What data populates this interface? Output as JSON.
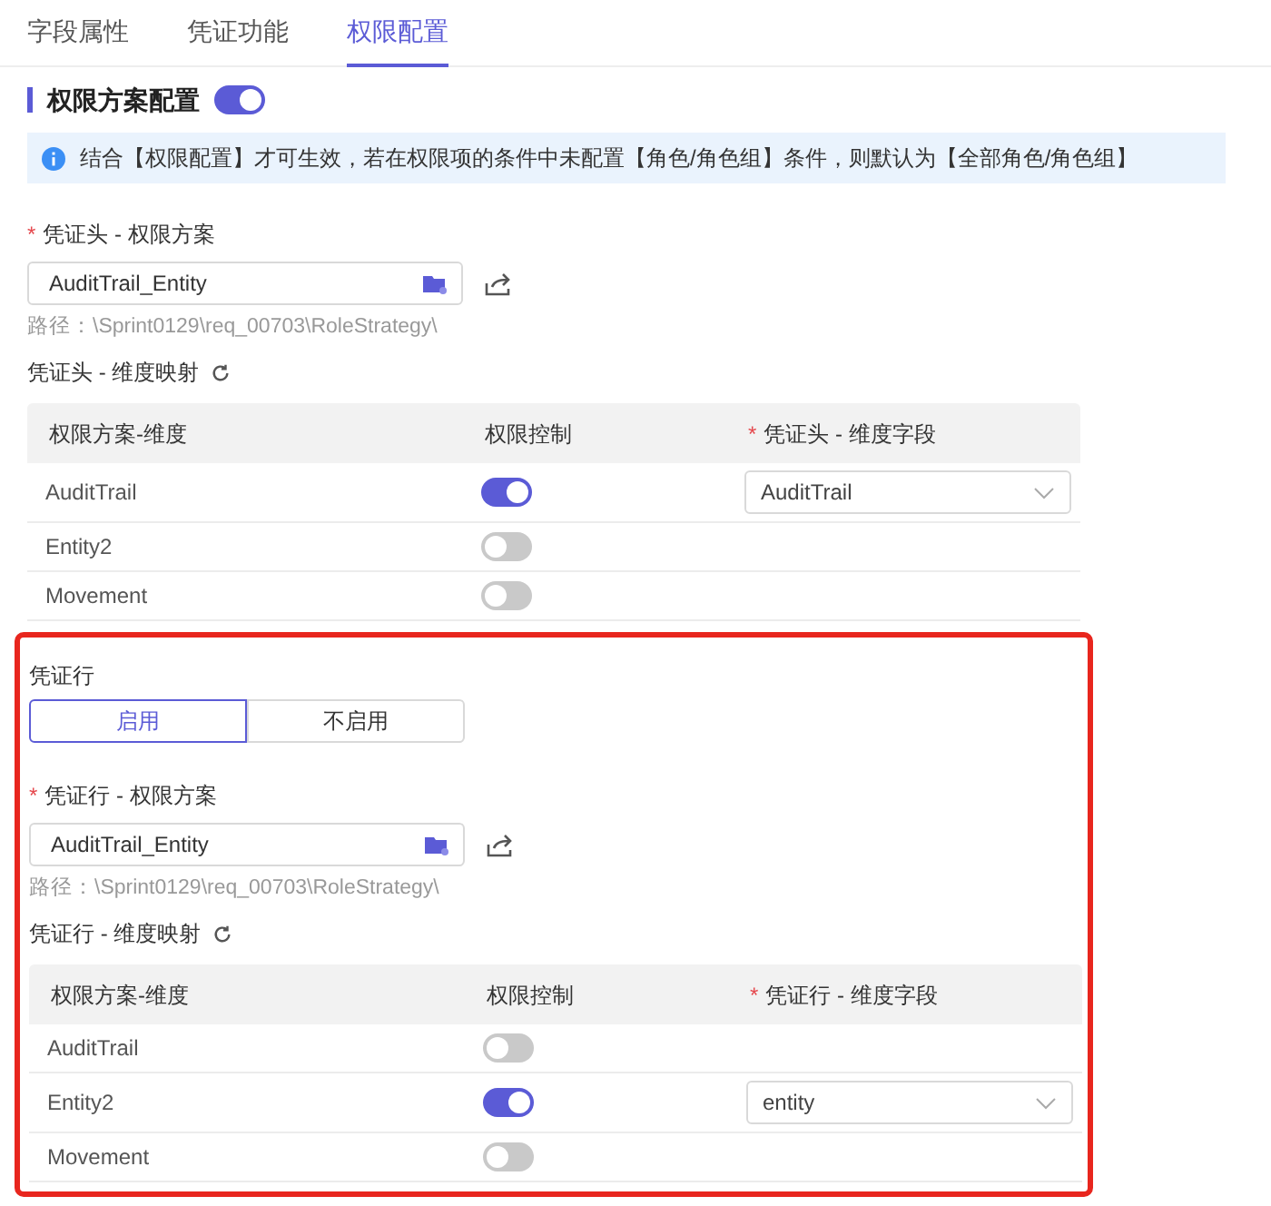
{
  "tabs": [
    {
      "label": "字段属性",
      "selected": false
    },
    {
      "label": "凭证功能",
      "selected": false
    },
    {
      "label": "权限配置",
      "selected": true
    }
  ],
  "section": {
    "title": "权限方案配置",
    "on": true
  },
  "notice": "结合【权限配置】才可生效，若在权限项的条件中未配置【角色/角色组】条件，则默认为【全部角色/角色组】",
  "header_scheme": {
    "required_mark": "*",
    "label": "凭证头 - 权限方案",
    "value": "AuditTrail_Entity",
    "path": "路径：\\Sprint0129\\req_00703\\RoleStrategy\\"
  },
  "header_mapping": {
    "title": "凭证头 - 维度映射",
    "columns": [
      {
        "label": "权限方案-维度"
      },
      {
        "label": "权限控制"
      },
      {
        "required_mark": "*",
        "label": "凭证头 - 维度字段"
      }
    ],
    "rows": [
      {
        "dimension": "AuditTrail",
        "on": true,
        "field": "AuditTrail"
      },
      {
        "dimension": "Entity2",
        "on": false
      },
      {
        "dimension": "Movement",
        "on": false
      }
    ]
  },
  "lines": {
    "label": "凭证行",
    "options": [
      {
        "label": "启用",
        "selected": true
      },
      {
        "label": "不启用",
        "selected": false
      }
    ],
    "scheme": {
      "required_mark": "*",
      "label": "凭证行 - 权限方案",
      "value": "AuditTrail_Entity",
      "path": "路径：\\Sprint0129\\req_00703\\RoleStrategy\\"
    },
    "mapping": {
      "title": "凭证行 - 维度映射",
      "columns": [
        {
          "label": "权限方案-维度"
        },
        {
          "label": "权限控制"
        },
        {
          "required_mark": "*",
          "label": "凭证行 - 维度字段"
        }
      ],
      "rows": [
        {
          "dimension": "AuditTrail",
          "on": false
        },
        {
          "dimension": "Entity2",
          "on": true,
          "field": "entity"
        },
        {
          "dimension": "Movement",
          "on": false
        }
      ]
    }
  }
}
